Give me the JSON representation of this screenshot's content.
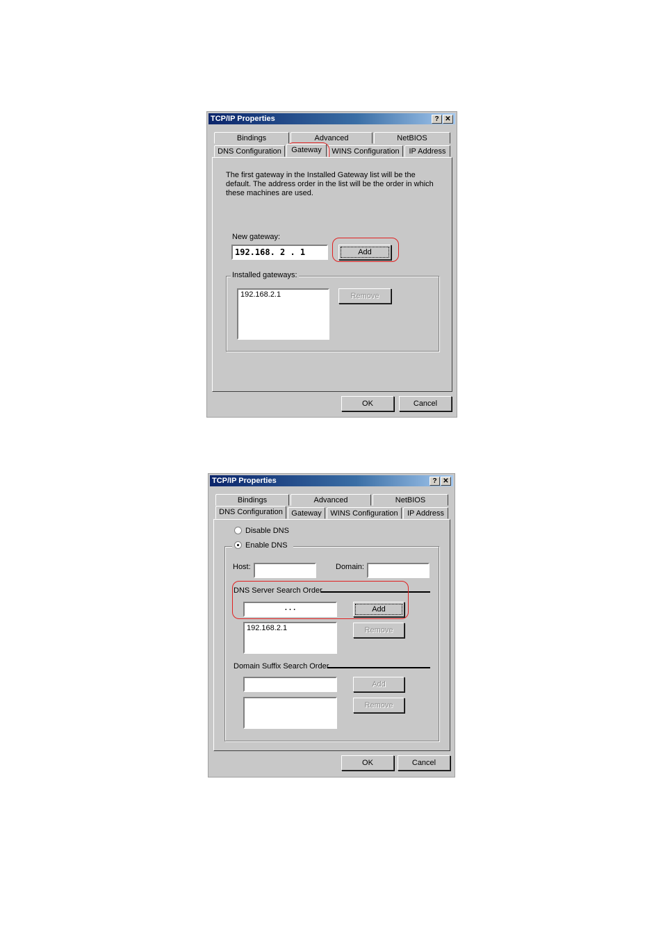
{
  "dialog1": {
    "title": "TCP/IP Properties",
    "help_btn": "?",
    "close_btn": "✕",
    "tabs_row1": [
      "Bindings",
      "Advanced",
      "NetBIOS"
    ],
    "tabs_row2": [
      "DNS Configuration",
      "Gateway",
      "WINS Configuration",
      "IP Address"
    ],
    "description": "The first gateway in the Installed Gateway list will be the default. The address order in the list will be the order in which these machines are used.",
    "new_gateway_label": "New gateway:",
    "new_gateway_value": "192.168. 2 . 1",
    "add_label": "Add",
    "installed_label": "Installed gateways:",
    "installed_items": [
      "192.168.2.1"
    ],
    "remove_label": "Remove",
    "ok_label": "OK",
    "cancel_label": "Cancel"
  },
  "dialog2": {
    "title": "TCP/IP Properties",
    "help_btn": "?",
    "close_btn": "✕",
    "tabs_row1": [
      "Bindings",
      "Advanced",
      "NetBIOS"
    ],
    "tabs_row2": [
      "DNS Configuration",
      "Gateway",
      "WINS Configuration",
      "IP Address"
    ],
    "disable_dns_label": "Disable DNS",
    "enable_dns_label": "Enable DNS",
    "host_label": "Host:",
    "domain_label": "Domain:",
    "dns_search_label": "DNS Server Search Order",
    "dns_input_value": ".        .        .",
    "add_label": "Add",
    "dns_list_items": [
      "192.168.2.1"
    ],
    "remove_label": "Remove",
    "suffix_label": "Domain Suffix Search Order",
    "suffix_add_label": "Add",
    "suffix_remove_label": "Remove",
    "ok_label": "OK",
    "cancel_label": "Cancel"
  },
  "colors": {
    "highlight": "#e02020",
    "titlebar_start": "#0a246a",
    "dialog_face": "#c8c8c8"
  }
}
